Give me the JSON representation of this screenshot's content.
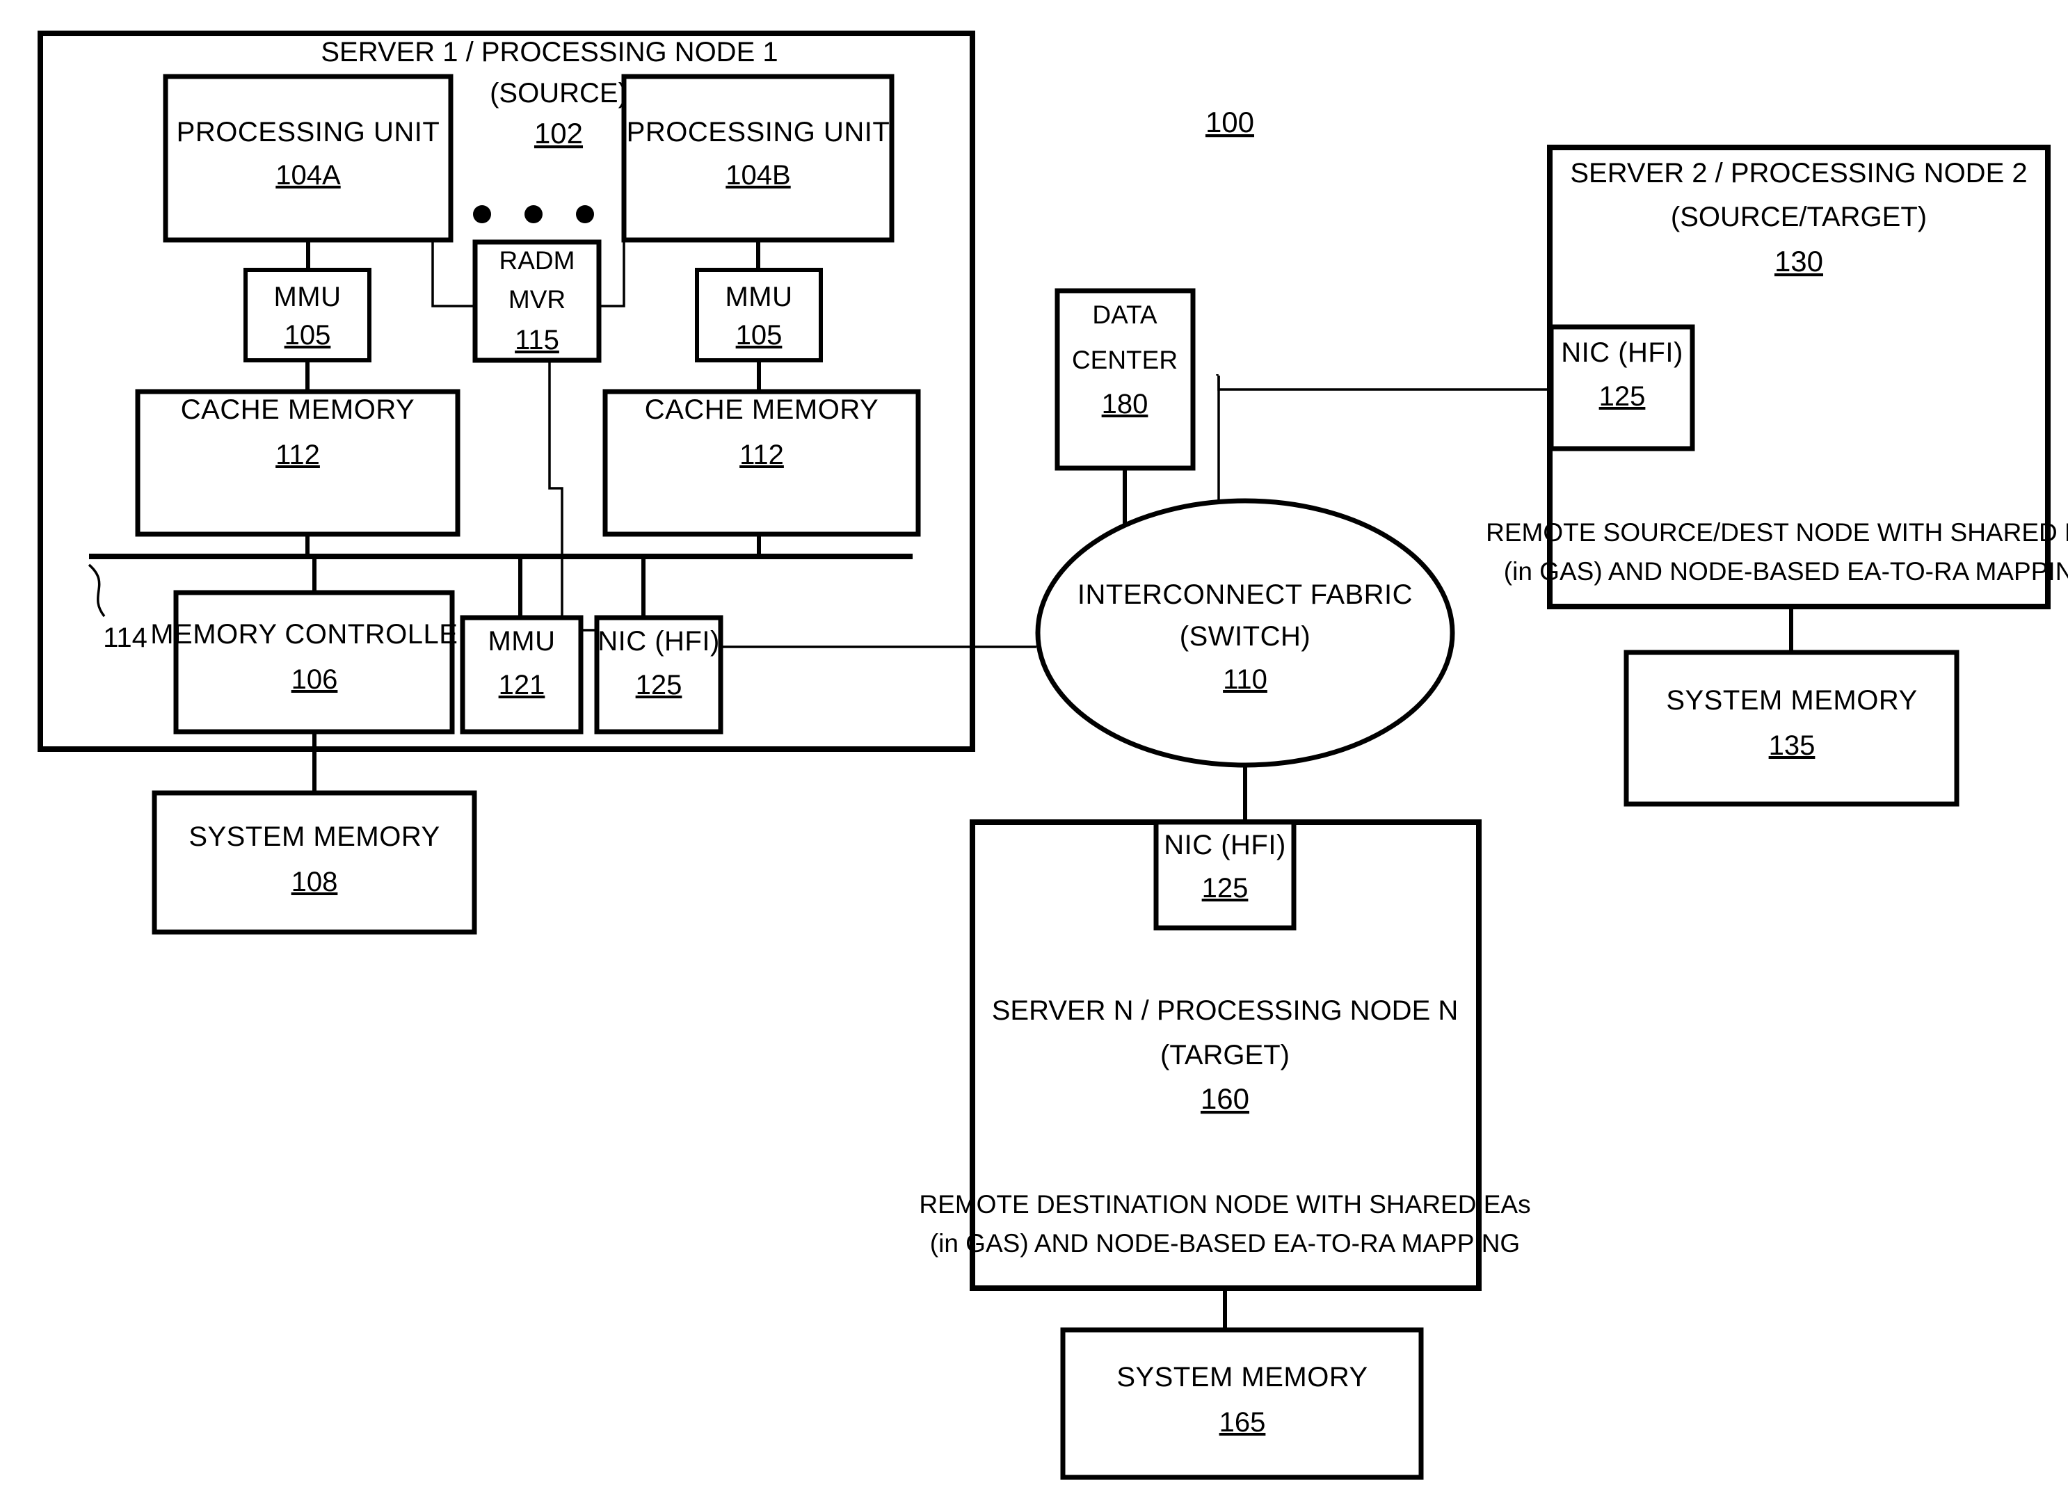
{
  "figure": {
    "label_100": "100"
  },
  "server1": {
    "title": "SERVER 1 / PROCESSING NODE 1",
    "subtitle": "(SOURCE)",
    "ref": "102",
    "processing_unit_a": {
      "label": "PROCESSING UNIT",
      "ref": "104A"
    },
    "processing_unit_b": {
      "label": "PROCESSING UNIT",
      "ref": "104B"
    },
    "mmu_left": {
      "label": "MMU",
      "ref": "105"
    },
    "mmu_right": {
      "label": "MMU",
      "ref": "105"
    },
    "radm": {
      "line1": "RADM",
      "line2": "MVR",
      "ref": "115"
    },
    "cache_left": {
      "label": "CACHE MEMORY",
      "ref": "112"
    },
    "cache_right": {
      "label": "CACHE MEMORY",
      "ref": "112"
    },
    "bus_ref": "114",
    "memory_controller": {
      "label": "MEMORY CONTROLLER",
      "ref": "106"
    },
    "mmu_io": {
      "label": "MMU",
      "ref": "121"
    },
    "nic": {
      "label": "NIC (HFI)",
      "ref": "125"
    },
    "system_memory": {
      "label": "SYSTEM MEMORY",
      "ref": "108"
    },
    "ellipsis_dots": 3
  },
  "data_center": {
    "line1": "DATA",
    "line2": "CENTER",
    "ref": "180"
  },
  "fabric": {
    "line1": "INTERCONNECT FABRIC",
    "line2": "(SWITCH)",
    "ref": "110"
  },
  "server2": {
    "title": "SERVER 2 / PROCESSING NODE 2",
    "subtitle": "(SOURCE/TARGET)",
    "ref": "130",
    "nic": {
      "label": "NIC (HFI)",
      "ref": "125"
    },
    "desc_line1": "REMOTE SOURCE/DEST NODE WITH SHARED EAs",
    "desc_line2": "(in GAS) AND NODE-BASED EA-TO-RA MAPPING",
    "system_memory": {
      "label": "SYSTEM MEMORY",
      "ref": "135"
    }
  },
  "serverN": {
    "title": "SERVER N / PROCESSING NODE N",
    "subtitle": "(TARGET)",
    "ref": "160",
    "nic": {
      "label": "NIC (HFI)",
      "ref": "125"
    },
    "desc_line1": "REMOTE DESTINATION NODE WITH SHARED EAs",
    "desc_line2": "(in GAS) AND NODE-BASED EA-TO-RA MAPPING",
    "system_memory": {
      "label": "SYSTEM MEMORY",
      "ref": "165"
    }
  },
  "colors": {
    "ink": "#000000",
    "paper": "#ffffff"
  }
}
